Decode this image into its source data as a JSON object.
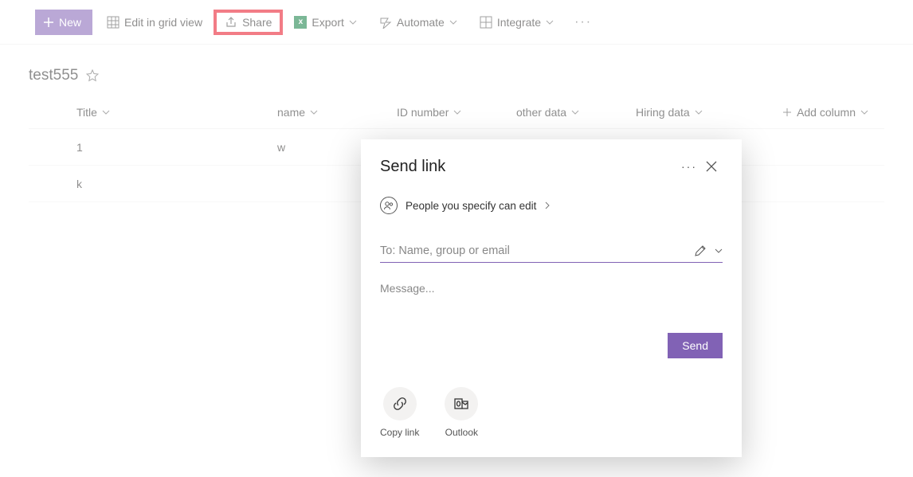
{
  "toolbar": {
    "new": "New",
    "edit_grid": "Edit in grid view",
    "share": "Share",
    "export": "Export",
    "automate": "Automate",
    "integrate": "Integrate"
  },
  "list": {
    "title": "test555",
    "columns": {
      "title": "Title",
      "name": "name",
      "id": "ID number",
      "other": "other data",
      "hiring": "Hiring data",
      "add": "Add column"
    },
    "rows": [
      {
        "title": "1",
        "name": "w"
      },
      {
        "title": "k",
        "name": ""
      }
    ]
  },
  "dialog": {
    "title": "Send link",
    "permission": "People you specify can edit",
    "to_placeholder": "To: Name, group or email",
    "message_placeholder": "Message...",
    "send": "Send",
    "copy_link": "Copy link",
    "outlook": "Outlook"
  }
}
